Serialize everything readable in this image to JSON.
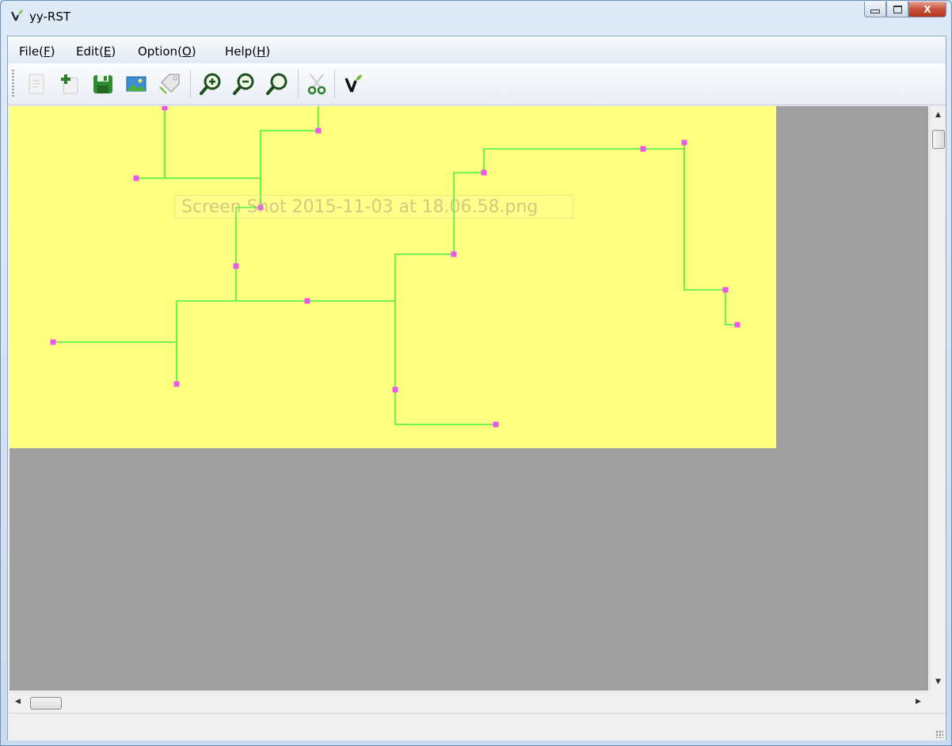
{
  "window": {
    "title": "yy-RST",
    "app_icon": "green-y-sprout-icon",
    "caption_buttons": {
      "minimize": "minimize-icon",
      "maximize": "maximize-icon",
      "close": "X"
    }
  },
  "menu": [
    {
      "name": "File",
      "accel": "F"
    },
    {
      "name": "Edit",
      "accel": "E"
    },
    {
      "name": "Option",
      "accel": "O"
    },
    {
      "name": "Help",
      "accel": "H"
    }
  ],
  "toolbar": {
    "buttons": [
      {
        "icon": "new-document-icon",
        "enabled": false
      },
      {
        "icon": "add-document-icon",
        "enabled": true
      },
      {
        "icon": "save-icon",
        "enabled": true
      },
      {
        "icon": "image-icon",
        "enabled": true
      },
      {
        "icon": "tag-icon",
        "enabled": true
      },
      {
        "icon": "zoom-in-icon",
        "enabled": true
      },
      {
        "icon": "zoom-out-icon",
        "enabled": true
      },
      {
        "icon": "zoom-fit-icon",
        "enabled": true
      },
      {
        "icon": "scissors-icon",
        "enabled": false
      },
      {
        "icon": "tree-icon",
        "enabled": true
      }
    ]
  },
  "canvas": {
    "watermark": "Screen Shot 2015-11-03 at 18.06.58.png",
    "background": "#ffff80",
    "edge_color": "#44ee44",
    "node_color": "#ee55ee",
    "view_background": "#a0a0a0"
  }
}
